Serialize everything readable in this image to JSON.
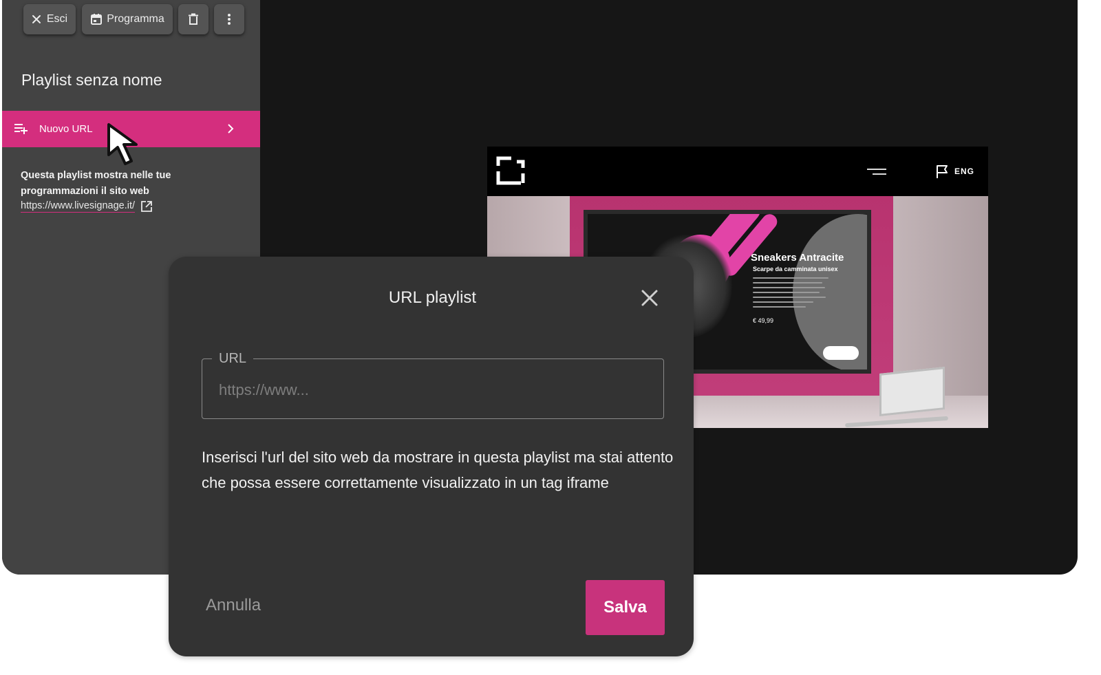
{
  "toolbar": {
    "exit_label": "Esci",
    "schedule_label": "Programma"
  },
  "sidebar": {
    "playlist_title": "Playlist senza nome",
    "new_url_label": "Nuovo URL",
    "info_text": "Questa playlist mostra nelle tue programmazioni il sito web",
    "info_link": "https://www.livesignage.it/"
  },
  "preview": {
    "lang_label": "ENG",
    "screen_title": "Sneakers Antracite",
    "screen_subtitle": "Scarpe da camminata unisex",
    "screen_price": "€ 49,99"
  },
  "modal": {
    "title": "URL playlist",
    "field_label": "URL",
    "field_value": "",
    "field_placeholder": "https://www...",
    "help_text": "Inserisci l'url del sito web da mostrare in questa playlist ma stai attento che possa essere correttamente visualizzato in un tag iframe",
    "cancel_label": "Annulla",
    "save_label": "Salva"
  },
  "colors": {
    "accent": "#d42e7e",
    "save_button": "#c8337c",
    "sidebar_bg": "#434343",
    "modal_bg": "#333333",
    "window_bg": "#161616"
  },
  "icons": [
    "close-icon",
    "calendar-icon",
    "trash-icon",
    "more-vert-icon",
    "playlist-add-icon",
    "chevron-right-icon",
    "cursor-arrow-icon",
    "external-link-icon",
    "site-logo-icon",
    "hamburger-menu-icon",
    "flag-icon"
  ]
}
